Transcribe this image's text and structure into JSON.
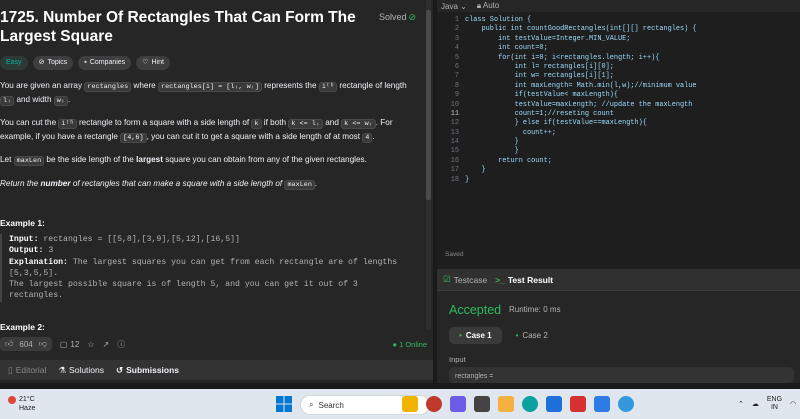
{
  "problem": {
    "title": "1725. Number Of Rectangles That Can Form The Largest Square",
    "solved_label": "Solved",
    "tags": [
      "Easy",
      "Topics",
      "Companies",
      "Hint"
    ],
    "p1_a": "You are given an array ",
    "p1_code1": "rectangles",
    "p1_b": " where ",
    "p1_code2": "rectangles[i] = [lᵢ, wᵢ]",
    "p1_c": " represents the ",
    "p1_code3": "iᵗʰ",
    "p1_d": " rectangle of length ",
    "p1_code4": "lᵢ",
    "p1_e": " and width ",
    "p1_code5": "wᵢ",
    "p1_f": ".",
    "p2_a": "You can cut the ",
    "p2_code1": "iᵗʰ",
    "p2_b": " rectangle to form a square with a side length of ",
    "p2_code2": "k",
    "p2_c": " if both ",
    "p2_code3": "k <= lᵢ",
    "p2_d": " and ",
    "p2_code4": "k <= wᵢ",
    "p2_e": ". For example, if you have a rectangle ",
    "p2_code5": "[4,6]",
    "p2_f": ", you can cut it to get a square with a side length of at most ",
    "p2_code6": "4",
    "p2_g": ".",
    "p3_a": "Let ",
    "p3_code1": "maxLen",
    "p3_b": " be the side length of the ",
    "p3_bold": "largest",
    "p3_c": " square you can obtain from any of the given rectangles.",
    "p4_a": "Return the ",
    "p4_bold": "number",
    "p4_b": " of rectangles that can make a square with a side length of ",
    "p4_code1": "maxLen",
    "p4_c": ".",
    "example1_title": "Example 1:",
    "ex_input_label": "Input:",
    "ex_input_value": " rectangles = [[5,8],[3,9],[5,12],[16,5]]",
    "ex_output_label": "Output:",
    "ex_output_value": " 3",
    "ex_expl_label": "Explanation:",
    "ex_expl_value": " The largest squares you can get from each rectangle are of lengths",
    "ex_expl_l2": "[5,3,5,5].",
    "ex_expl_l3": "The largest possible square is of length 5, and you can get it out of 3",
    "ex_expl_l4": "rectangles.",
    "example2_title": "Example 2:"
  },
  "footer": {
    "likes": "604",
    "comments": "12",
    "online": "1 Online"
  },
  "bottom_tabs": [
    "Editorial",
    "Solutions",
    "Submissions"
  ],
  "editor": {
    "language": "Java",
    "mode": "Auto",
    "lines": [
      {
        "n": "1",
        "t": "class Solution {"
      },
      {
        "n": "2",
        "t": "    public int countGoodRectangles(int[][] rectangles) {"
      },
      {
        "n": "3",
        "t": "        int testValue=Integer.MIN_VALUE;"
      },
      {
        "n": "4",
        "t": "        int count=0;"
      },
      {
        "n": "5",
        "t": "        for(int i=0; i<rectangles.length; i++){"
      },
      {
        "n": "6",
        "t": "            int l= rectangles[i][0];"
      },
      {
        "n": "7",
        "t": "            int w= rectangles[i][1];"
      },
      {
        "n": "8",
        "t": "            int maxLength= Math.min(l,w);//minimum value"
      },
      {
        "n": "9",
        "t": "            if(testValue< maxLength){"
      },
      {
        "n": "10",
        "t": "            testValue=maxLength; //update the maxLength"
      },
      {
        "n": "11",
        "t": "            count=1;//reseting count"
      },
      {
        "n": "12",
        "t": "            } else if(testValue==maxLength){"
      },
      {
        "n": "13",
        "t": "              count++;"
      },
      {
        "n": "14",
        "t": "            }"
      },
      {
        "n": "15",
        "t": "            }"
      },
      {
        "n": "16",
        "t": "        return count;"
      },
      {
        "n": "17",
        "t": "    }"
      },
      {
        "n": "18",
        "t": "}"
      }
    ],
    "saved": "Saved"
  },
  "result_panel": {
    "tabs": [
      "Testcase",
      "Test Result"
    ],
    "status": "Accepted",
    "runtime": "Runtime: 0 ms",
    "cases": [
      "Case 1",
      "Case 2"
    ],
    "input_label": "Input",
    "input_value": "rectangles ="
  },
  "taskbar": {
    "temperature": "21°C",
    "weather": "Haze",
    "search": "Search",
    "lang": "ENG",
    "region": "IN"
  },
  "colors": {
    "accent_green": "#2cbb5d",
    "easy": "#00b8a3"
  }
}
